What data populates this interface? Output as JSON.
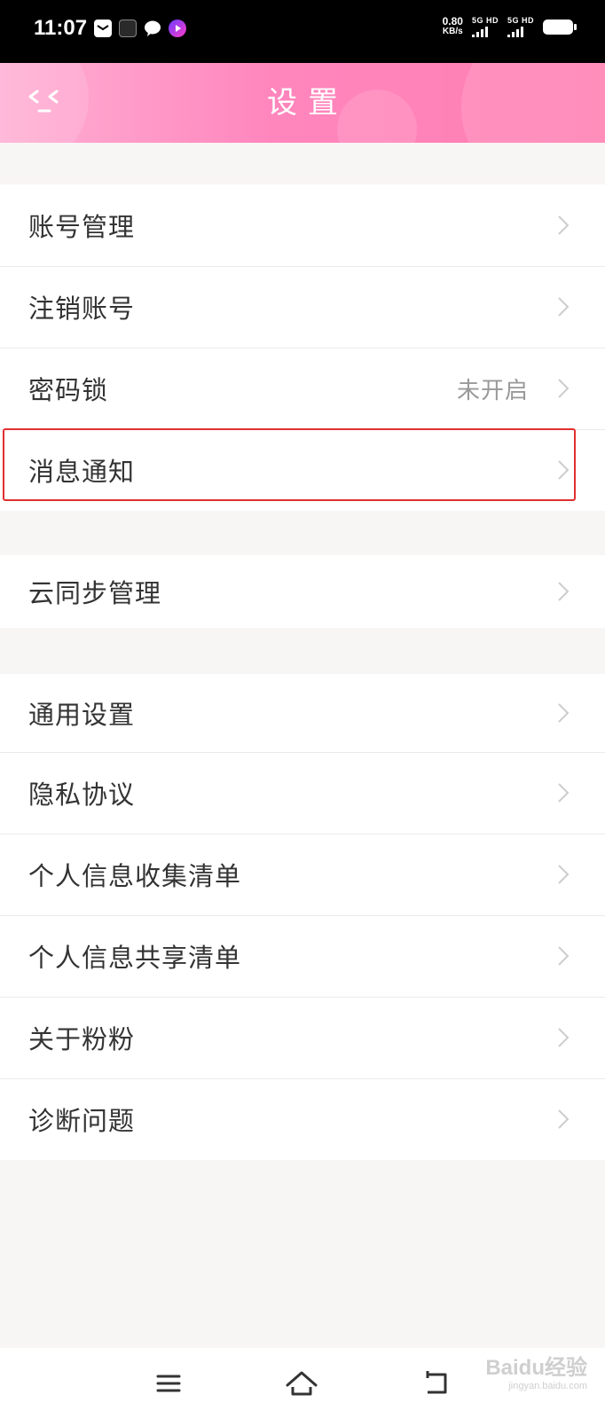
{
  "status_bar": {
    "time": "11:07",
    "net_speed_value": "0.80",
    "net_speed_unit": "KB/s",
    "sim1_label": "5G HD",
    "sim2_label": "5G HD",
    "icons": [
      "mail-icon",
      "app-icon",
      "chat-bubble-icon",
      "video-app-icon"
    ]
  },
  "header": {
    "title": "设置",
    "back_icon": "back-icon",
    "background_colors": [
      "#ffb0d4",
      "#ff7fb2"
    ]
  },
  "settings": {
    "group1": [
      {
        "label": "账号管理"
      },
      {
        "label": "注销账号"
      },
      {
        "label": "密码锁",
        "value": "未开启"
      },
      {
        "label": "消息通知",
        "highlighted": true
      }
    ],
    "group2": [
      {
        "label": "云同步管理"
      }
    ],
    "group3": [
      {
        "label": "通用设置"
      },
      {
        "label": "隐私协议"
      },
      {
        "label": "个人信息收集清单"
      },
      {
        "label": "个人信息共享清单"
      },
      {
        "label": "关于粉粉"
      },
      {
        "label": "诊断问题"
      }
    ]
  },
  "nav_bar": {
    "icons": [
      "menu-icon",
      "home-icon",
      "back-nav-icon"
    ]
  },
  "watermark": {
    "text": "Baidu经验",
    "subtext": "jingyan.baidu.com"
  },
  "colors": {
    "highlight_border": "#e0302f",
    "accent_pink": "#ff86bd",
    "text_primary": "#333333",
    "text_secondary": "#999999"
  }
}
